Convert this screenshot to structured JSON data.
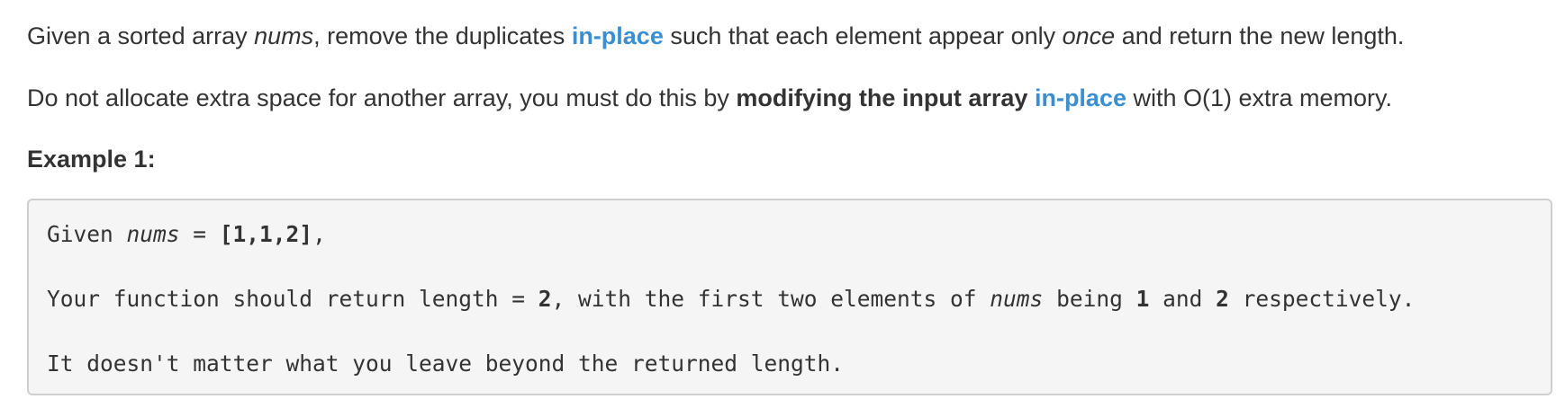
{
  "paragraph1": {
    "t1": "Given a sorted array ",
    "t2": "nums",
    "t3": ", remove the duplicates ",
    "link": "in-place",
    "t4": " such that each element appear only ",
    "t5": "once",
    "t6": " and return the new length."
  },
  "paragraph2": {
    "t1": "Do not allocate extra space for another array, you must do this by ",
    "bold": "modifying the input array",
    "t2": " ",
    "link": "in-place",
    "t3": " with O(1) extra memory."
  },
  "example_heading": "Example 1:",
  "code": {
    "line1": {
      "t1": "Given ",
      "t2": "nums",
      "t3": " = ",
      "t4": "[1,1,2]",
      "t5": ","
    },
    "line2": {
      "t1": "Your function should return length = ",
      "t2": "2",
      "t3": ", with the first two elements of ",
      "t4": "nums",
      "t5": " being ",
      "t6": "1",
      "t7": " and ",
      "t8": "2",
      "t9": " respectively."
    },
    "line3": {
      "t1": "It doesn't matter what you leave beyond the returned length."
    }
  },
  "colors": {
    "text": "#333333",
    "link": "#3b8fd1",
    "code_background": "#f5f5f5",
    "code_border": "#cfcfcf"
  }
}
